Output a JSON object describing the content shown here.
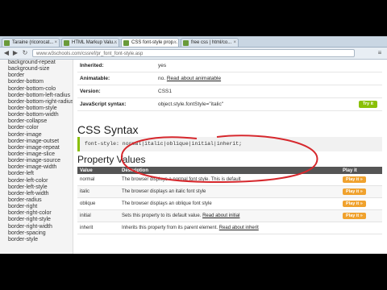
{
  "tabs": [
    {
      "label": "Taraine (ricorocat...",
      "active": false
    },
    {
      "label": "HTML Markup Valu...",
      "active": false
    },
    {
      "label": "CSS font-style prop...",
      "active": true
    },
    {
      "label": "free css | html/co...",
      "active": false
    }
  ],
  "address": {
    "url": "www.w3schools.com/cssref/pr_font_font-style.asp"
  },
  "sidebar": {
    "items": [
      "background-repeat",
      "background-size",
      "border",
      "border-bottom",
      "border-bottom-colo",
      "border-bottom-left-radius",
      "border-bottom-right-radius",
      "border-bottom-style",
      "border-bottom-width",
      "border-collapse",
      "border-color",
      "border-image",
      "border-image-outset",
      "border-image-repeat",
      "border-image-slice",
      "border-image-source",
      "border-image-width",
      "border-left",
      "border-left-color",
      "border-left-style",
      "border-left-width",
      "border-radius",
      "border-right",
      "border-right-color",
      "border-right-style",
      "border-right-width",
      "border-spacing",
      "border-style"
    ]
  },
  "properties": [
    {
      "key": "Inherited:",
      "value": "yes",
      "link": ""
    },
    {
      "key": "Animatable:",
      "value": "no.",
      "link": "Read about animatable"
    },
    {
      "key": "Version:",
      "value": "CSS1",
      "link": ""
    },
    {
      "key": "JavaScript syntax:",
      "value": "object.style.fontStyle=\"italic\"",
      "link": ""
    }
  ],
  "tryit_label": "Try it",
  "syntax": {
    "heading": "CSS Syntax",
    "code": "font-style: normal|italic|oblique|initial|inherit;"
  },
  "values": {
    "heading": "Property Values",
    "headers": [
      "Value",
      "Description",
      "Play it"
    ],
    "rows": [
      {
        "value": "normal",
        "description": "The browser displays a normal font style. This is default",
        "link": "",
        "play": "Play it »"
      },
      {
        "value": "italic",
        "description": "The browser displays an italic font style",
        "link": "",
        "play": "Play it »"
      },
      {
        "value": "oblique",
        "description": "The browser displays an oblique font style",
        "link": "",
        "play": "Play it »"
      },
      {
        "value": "initial",
        "description": "Sets this property to its default value.",
        "link": "Read about initial",
        "play": "Play it »"
      },
      {
        "value": "inherit",
        "description": "Inherits this property from its parent element.",
        "link": "Read about inherit",
        "play": ""
      }
    ]
  },
  "colors": {
    "accent": "#8ac007",
    "play": "#f0a22e",
    "annotation": "#d6282d",
    "header": "#555555"
  }
}
